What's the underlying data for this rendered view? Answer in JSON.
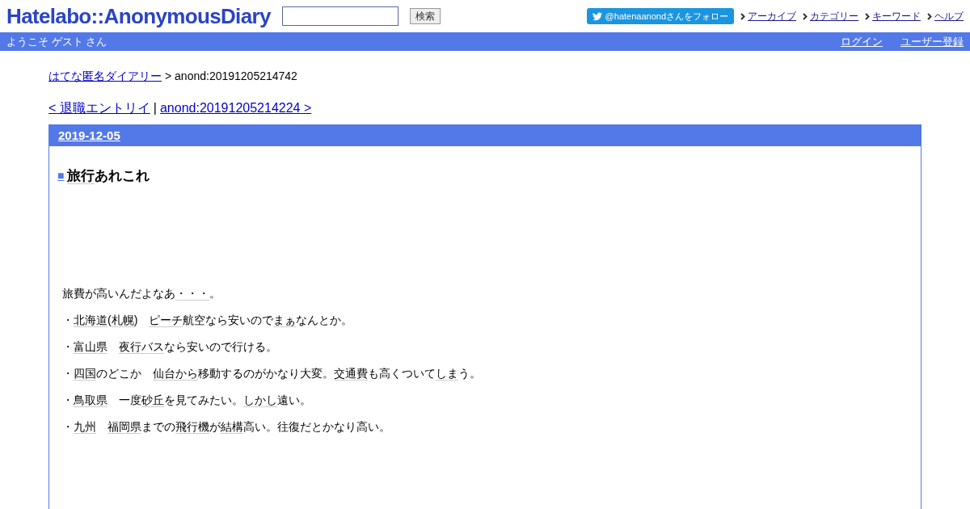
{
  "header": {
    "logo": "Hatelabo::AnonymousDiary",
    "search": {
      "button": "検索"
    },
    "follow_button": "@hatenaanondさんをフォロー",
    "nav": [
      "アーカイブ",
      "カテゴリー",
      "キーワード",
      "ヘルプ"
    ]
  },
  "welcome_bar": {
    "greeting": "ようこそ ゲスト さん",
    "links": [
      "ログイン",
      "ユーザー登録"
    ]
  },
  "breadcrumb": {
    "link": "はてな匿名ダイアリー",
    "current": "> anond:20191205214742"
  },
  "pager": {
    "prev": "< 退職エントリイ",
    "separator": "|",
    "next": "anond:20191205214224 >"
  },
  "entry": {
    "date": "2019-12-05",
    "title_marker": "■",
    "title": [
      {
        "kind": "keyword",
        "text": "旅行"
      },
      {
        "kind": "text",
        "text": "あれこれ"
      }
    ],
    "paragraphs": [
      [
        {
          "kind": "text",
          "text": "旅費が高いんだよなあ"
        },
        {
          "kind": "keyword",
          "text": "・・・"
        },
        {
          "kind": "text",
          "text": "。"
        }
      ],
      [
        {
          "kind": "text",
          "text": "・"
        },
        {
          "kind": "keyword",
          "text": "北海道"
        },
        {
          "kind": "text",
          "text": "("
        },
        {
          "kind": "keyword",
          "text": "札幌"
        },
        {
          "kind": "text",
          "text": ")"
        },
        {
          "kind": "gap"
        },
        {
          "kind": "keyword",
          "text": "ピーチ"
        },
        {
          "kind": "text",
          "text": "航空なら安いので"
        },
        {
          "kind": "keyword",
          "text": "まぁ"
        },
        {
          "kind": "text",
          "text": "なんとか。"
        }
      ],
      [
        {
          "kind": "text",
          "text": "・"
        },
        {
          "kind": "keyword",
          "text": "富山県"
        },
        {
          "kind": "gap"
        },
        {
          "kind": "keyword",
          "text": "夜行バス"
        },
        {
          "kind": "text",
          "text": "なら安いので行ける。"
        }
      ],
      [
        {
          "kind": "text",
          "text": "・"
        },
        {
          "kind": "keyword",
          "text": "四国"
        },
        {
          "kind": "text",
          "text": "のどこか"
        },
        {
          "kind": "gap"
        },
        {
          "kind": "keyword",
          "text": "仙台から"
        },
        {
          "kind": "text",
          "text": "移動するのがかなり大変。"
        },
        {
          "kind": "keyword",
          "text": "交通費"
        },
        {
          "kind": "text",
          "text": "も高くついて"
        },
        {
          "kind": "keyword",
          "text": "しま"
        },
        {
          "kind": "text",
          "text": "う。"
        }
      ],
      [
        {
          "kind": "text",
          "text": "・"
        },
        {
          "kind": "keyword",
          "text": "鳥取県"
        },
        {
          "kind": "gap"
        },
        {
          "kind": "text",
          "text": "一度"
        },
        {
          "kind": "keyword",
          "text": "砂丘"
        },
        {
          "kind": "text",
          "text": "を見てみたい。"
        },
        {
          "kind": "keyword",
          "text": "しかし"
        },
        {
          "kind": "text",
          "text": "遠い。"
        }
      ],
      [
        {
          "kind": "text",
          "text": "・"
        },
        {
          "kind": "keyword",
          "text": "九州"
        },
        {
          "kind": "gap"
        },
        {
          "kind": "keyword",
          "text": "福岡県"
        },
        {
          "kind": "text",
          "text": "までの"
        },
        {
          "kind": "keyword",
          "text": "飛行機"
        },
        {
          "kind": "text",
          "text": "が"
        },
        {
          "kind": "keyword",
          "text": "結構"
        },
        {
          "kind": "text",
          "text": "高い。往復だとかなり高い。"
        }
      ]
    ]
  }
}
